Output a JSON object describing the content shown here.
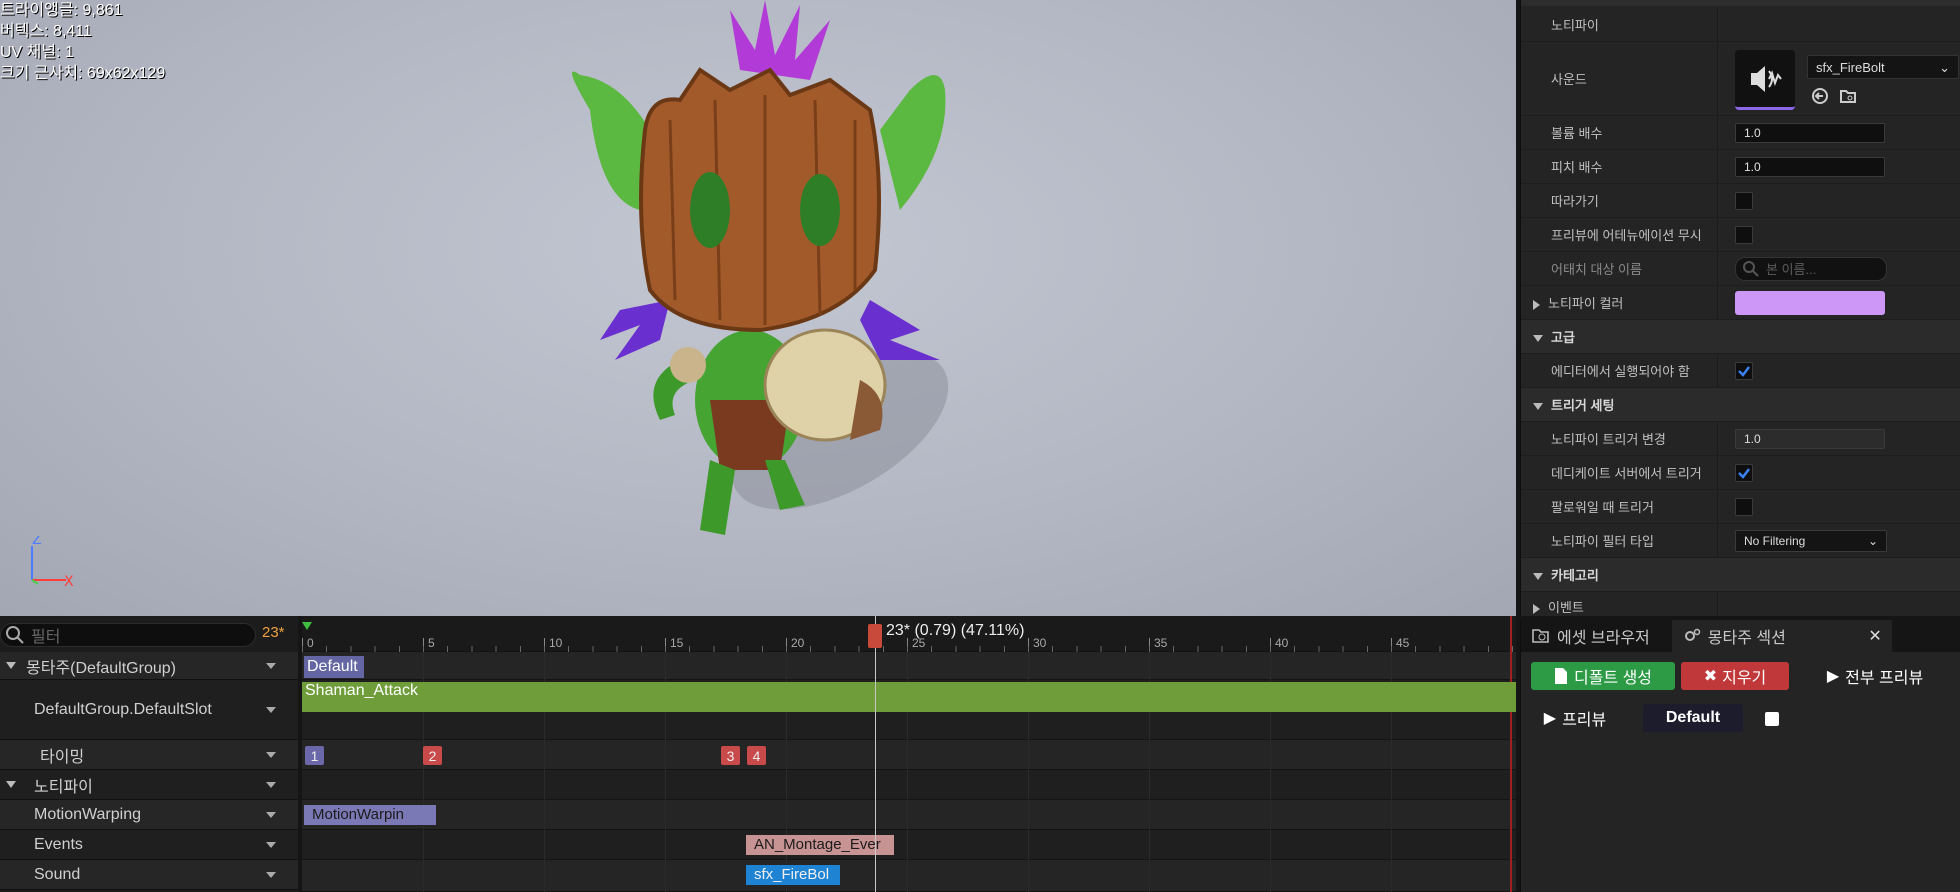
{
  "viewport": {
    "stats": [
      "트라이앵글: 9,861",
      "버텍스: 8,411",
      "UV 채널: 1",
      "크기 근사치: 69x62x129"
    ],
    "axis": {
      "z": "Z",
      "x": "X"
    }
  },
  "details": {
    "notify_header": "노티파이",
    "sound_label": "사운드",
    "sound_asset": "sfx_FireBolt",
    "volume_label": "볼륨 배수",
    "volume_value": "1.0",
    "pitch_label": "피치 배수",
    "pitch_value": "1.0",
    "follow_label": "따라가기",
    "ignore_attn_label": "프리뷰에 어테뉴에이션 무시",
    "attach_label": "어태치 대상 이름",
    "attach_placeholder": "본 이름...",
    "notify_color_label": "노티파이 컬러",
    "notify_color": "#cc97f7",
    "advanced_cat": "고급",
    "editor_run_label": "에디터에서 실행되어야 함",
    "editor_run_checked": true,
    "trigger_cat": "트리거 세팅",
    "trigger_change_label": "노티파이 트리거 변경",
    "trigger_change_value": "1.0",
    "dedicated_label": "데디케이트 서버에서 트리거",
    "dedicated_checked": true,
    "follower_label": "팔로워일 때 트리거",
    "follower_checked": false,
    "filter_type_label": "노티파이 필터 타입",
    "filter_type_value": "No Filtering",
    "category_cat": "카테고리",
    "event_label": "이벤트"
  },
  "timeline": {
    "filter_placeholder": "필터",
    "current_frame": "23*",
    "playhead_label": "23* (0.79) (47.11%)",
    "ruler": [
      "0",
      "5",
      "10",
      "15",
      "20",
      "25",
      "30",
      "35",
      "40",
      "45"
    ],
    "tracks": {
      "montage": "몽타주(DefaultGroup)",
      "slot": "DefaultGroup.DefaultSlot",
      "timing": "타이밍",
      "notify": "노티파이",
      "motion": "MotionWarping",
      "events": "Events",
      "sound": "Sound"
    },
    "segments": {
      "section": "Default",
      "anim": "Shaman_Attack",
      "motion_notify": "MotionWarpin",
      "event_notify": "AN_Montage_Ever",
      "sound_notify": "sfx_FireBol"
    },
    "timing_markers": [
      "1",
      "2",
      "3",
      "4"
    ]
  },
  "bottom_panel": {
    "tab_asset_browser": "에셋 브라우저",
    "tab_montage_sections": "몽타주 섹션",
    "create_default": "디폴트 생성",
    "clear": "지우기",
    "preview_all": "전부 프리뷰",
    "preview": "프리뷰",
    "section_name": "Default"
  },
  "colors": {
    "anim_bar": "#6f9d3a",
    "marker_blue": "#6a68a8",
    "marker_red": "#c84a4a",
    "accent_orange": "#e07a3a",
    "create_btn": "#2d9a46",
    "clear_btn": "#c0383a"
  }
}
